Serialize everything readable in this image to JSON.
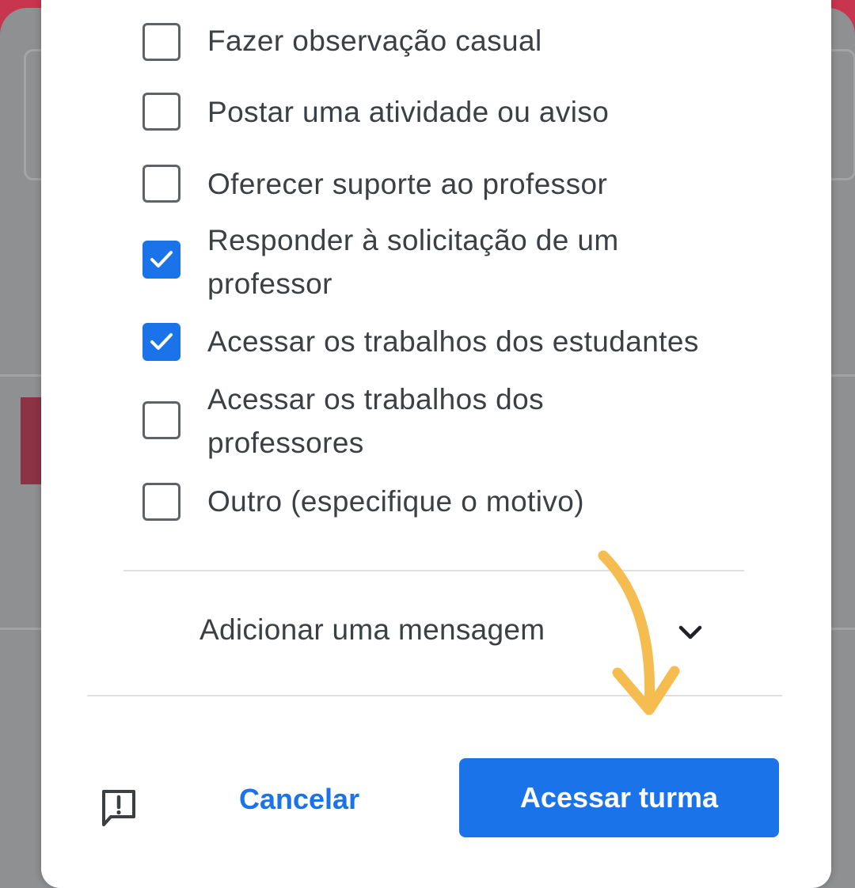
{
  "dialog": {
    "options": [
      {
        "label": "Fazer observação casual",
        "checked": false
      },
      {
        "label": "Postar uma atividade ou aviso",
        "checked": false
      },
      {
        "label": "Oferecer suporte ao professor",
        "checked": false
      },
      {
        "label_line1": "Responder à solicitação de um",
        "label_line2": "professor",
        "checked": true
      },
      {
        "label": "Acessar os trabalhos dos estudantes",
        "checked": true
      },
      {
        "label_line1": "Acessar os trabalhos dos",
        "label_line2": "professores",
        "checked": false
      },
      {
        "label": "Outro (especifique o motivo)",
        "checked": false
      }
    ],
    "message_section": {
      "label": "Adicionar uma mensagem",
      "icon": "chevron-down-icon"
    },
    "footer": {
      "feedback_icon": "feedback-icon",
      "cancel_label": "Cancelar",
      "confirm_label": "Acessar turma"
    }
  },
  "colors": {
    "page_frame": "#c8354f",
    "backdrop": "#8f9092",
    "accent": "#1a73e8",
    "annotation_arrow": "#f5bd4f"
  }
}
